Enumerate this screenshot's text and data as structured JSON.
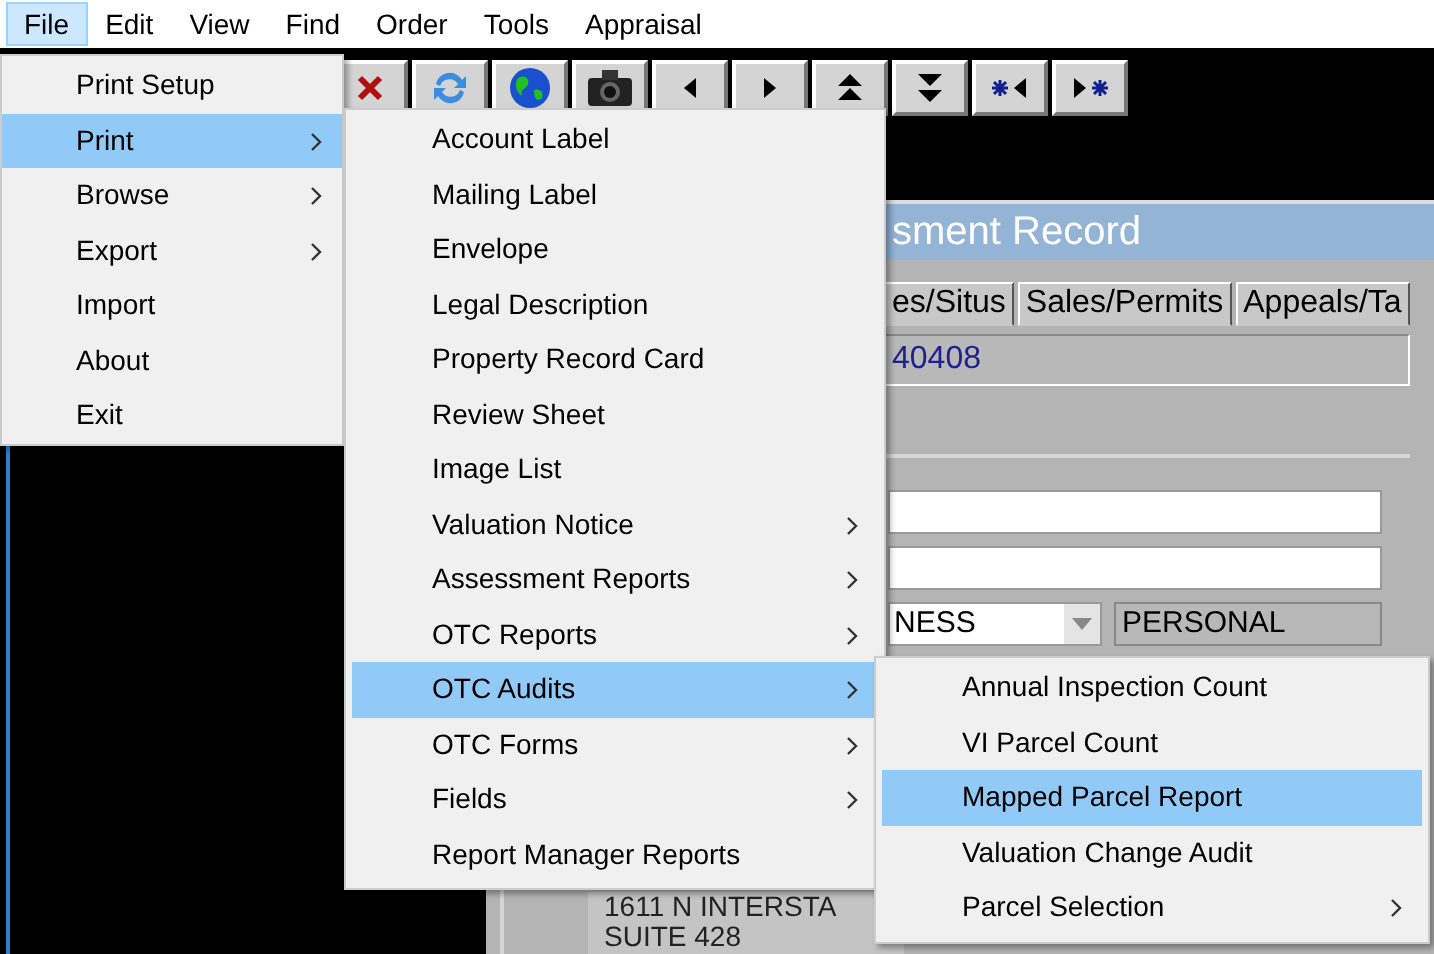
{
  "menu_bar": [
    {
      "label": "File",
      "selected": true
    },
    {
      "label": "Edit",
      "selected": false
    },
    {
      "label": "View",
      "selected": false
    },
    {
      "label": "Find",
      "selected": false
    },
    {
      "label": "Order",
      "selected": false
    },
    {
      "label": "Tools",
      "selected": false
    },
    {
      "label": "Appraisal",
      "selected": false
    }
  ],
  "file_menu": [
    {
      "label": "Print Setup",
      "has_submenu": false,
      "selected": false
    },
    {
      "label": "Print",
      "has_submenu": true,
      "selected": true
    },
    {
      "label": "Browse",
      "has_submenu": true,
      "selected": false
    },
    {
      "label": "Export",
      "has_submenu": true,
      "selected": false
    },
    {
      "label": "Import",
      "has_submenu": false,
      "selected": false
    },
    {
      "label": "About",
      "has_submenu": false,
      "selected": false
    },
    {
      "label": "Exit",
      "has_submenu": false,
      "selected": false
    }
  ],
  "print_menu": [
    {
      "label": "Account Label",
      "has_submenu": false,
      "selected": false
    },
    {
      "label": "Mailing Label",
      "has_submenu": false,
      "selected": false
    },
    {
      "label": "Envelope",
      "has_submenu": false,
      "selected": false
    },
    {
      "label": "Legal Description",
      "has_submenu": false,
      "selected": false
    },
    {
      "label": "Property Record Card",
      "has_submenu": false,
      "selected": false
    },
    {
      "label": "Review Sheet",
      "has_submenu": false,
      "selected": false
    },
    {
      "label": "Image List",
      "has_submenu": false,
      "selected": false
    },
    {
      "label": "Valuation Notice",
      "has_submenu": true,
      "selected": false
    },
    {
      "label": "Assessment Reports",
      "has_submenu": true,
      "selected": false
    },
    {
      "label": "OTC Reports",
      "has_submenu": true,
      "selected": false
    },
    {
      "label": "OTC Audits",
      "has_submenu": true,
      "selected": true
    },
    {
      "label": "OTC Forms",
      "has_submenu": true,
      "selected": false
    },
    {
      "label": "Fields",
      "has_submenu": true,
      "selected": false
    },
    {
      "label": "Report Manager Reports",
      "has_submenu": false,
      "selected": false
    }
  ],
  "otc_audits_menu": [
    {
      "label": "Annual Inspection Count",
      "has_submenu": false,
      "selected": false
    },
    {
      "label": "VI Parcel Count",
      "has_submenu": false,
      "selected": false
    },
    {
      "label": "Mapped Parcel Report",
      "has_submenu": false,
      "selected": true
    },
    {
      "label": "Valuation Change Audit",
      "has_submenu": false,
      "selected": false
    },
    {
      "label": "Parcel Selection",
      "has_submenu": true,
      "selected": false
    }
  ],
  "record_window": {
    "title": "sment Record",
    "tabs": [
      {
        "label": "es/Situs",
        "selected": false
      },
      {
        "label": "Sales/Permits",
        "selected": false
      },
      {
        "label": "Appeals/Ta",
        "selected": false
      }
    ],
    "account_field": "40408",
    "dropdown_value": "NESS",
    "type_field": "PERSONAL",
    "address_lines": [
      "1611 N INTERSTA",
      "SUITE 428"
    ]
  }
}
